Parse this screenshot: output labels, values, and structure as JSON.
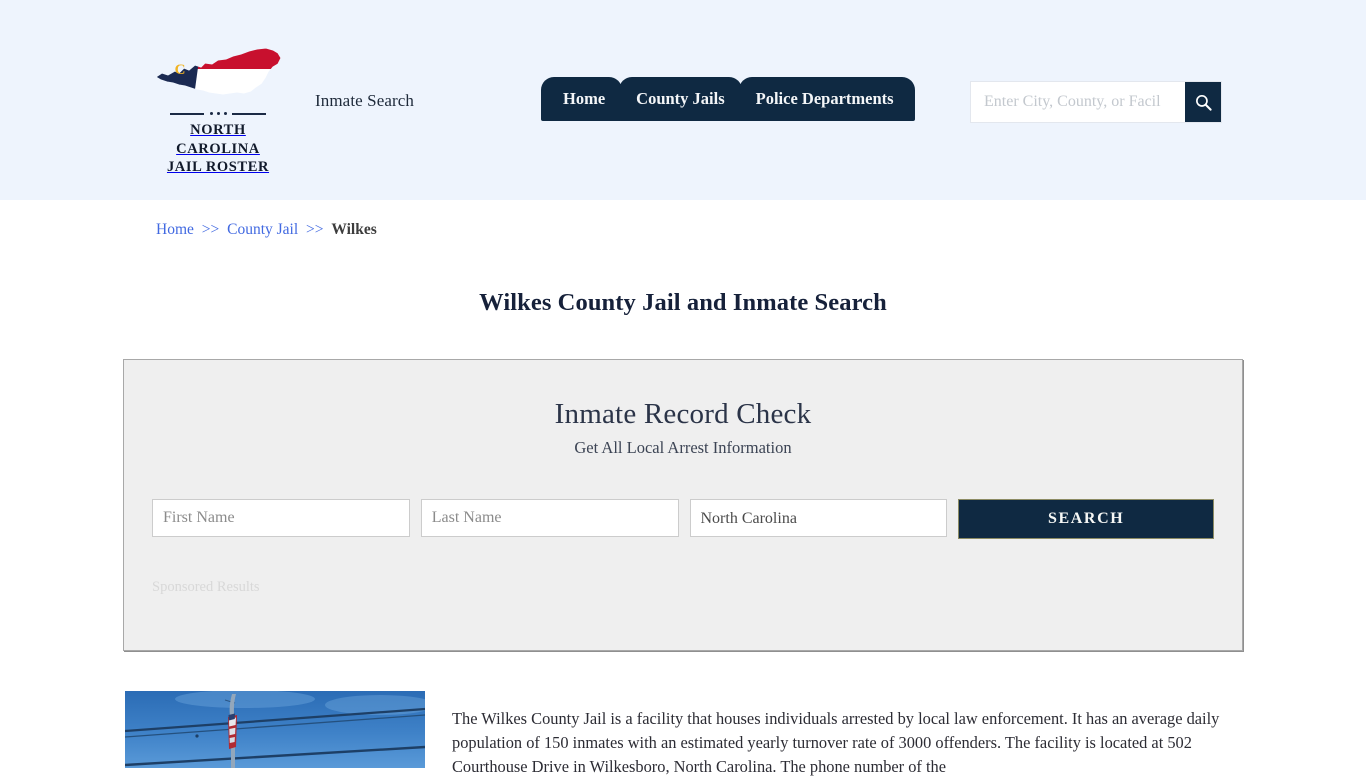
{
  "header": {
    "logo": {
      "icon": "north-carolina-map-icon",
      "name_line1": "NORTH CAROLINA",
      "name_line2": "JAIL ROSTER",
      "colors": {
        "navy": "#1b2a52",
        "red": "#c8102e",
        "white": "#ffffff",
        "gold": "#f0b323"
      }
    },
    "tagline": "Inmate Search",
    "nav": [
      {
        "label": "Home"
      },
      {
        "label": "County Jails"
      },
      {
        "label": "Police Departments"
      }
    ],
    "search": {
      "value": "",
      "placeholder": "Enter City, County, or Facil",
      "button_icon": "search-icon"
    },
    "background_color": "#eef4fd",
    "accent_color": "#0f2942"
  },
  "breadcrumb": {
    "items": [
      {
        "label": "Home",
        "current": false
      },
      {
        "label": "County Jail",
        "current": false
      },
      {
        "label": "Wilkes",
        "current": true
      }
    ],
    "separator": ">>"
  },
  "page": {
    "title": "Wilkes County Jail and Inmate Search"
  },
  "record_check": {
    "title": "Inmate Record Check",
    "subtitle": "Get All Local Arrest Information",
    "first_name": {
      "value": "",
      "placeholder": "First Name"
    },
    "last_name": {
      "value": "",
      "placeholder": "Last Name"
    },
    "state": {
      "selected": "North Carolina",
      "options": [
        "North Carolina"
      ]
    },
    "submit_label": "SEARCH",
    "sponsored_label": "Sponsored Results"
  },
  "content": {
    "thumbnail": {
      "icon": "flagpole-photo",
      "description": "American flag on a pole against blue sky with power lines"
    },
    "paragraph": "The Wilkes County Jail is a facility that houses individuals arrested by local law enforcement. It has an average daily population of 150 inmates with an estimated yearly turnover rate of 3000 offenders. The facility is located at 502 Courthouse Drive in Wilkesboro, North Carolina. The phone number of the"
  }
}
